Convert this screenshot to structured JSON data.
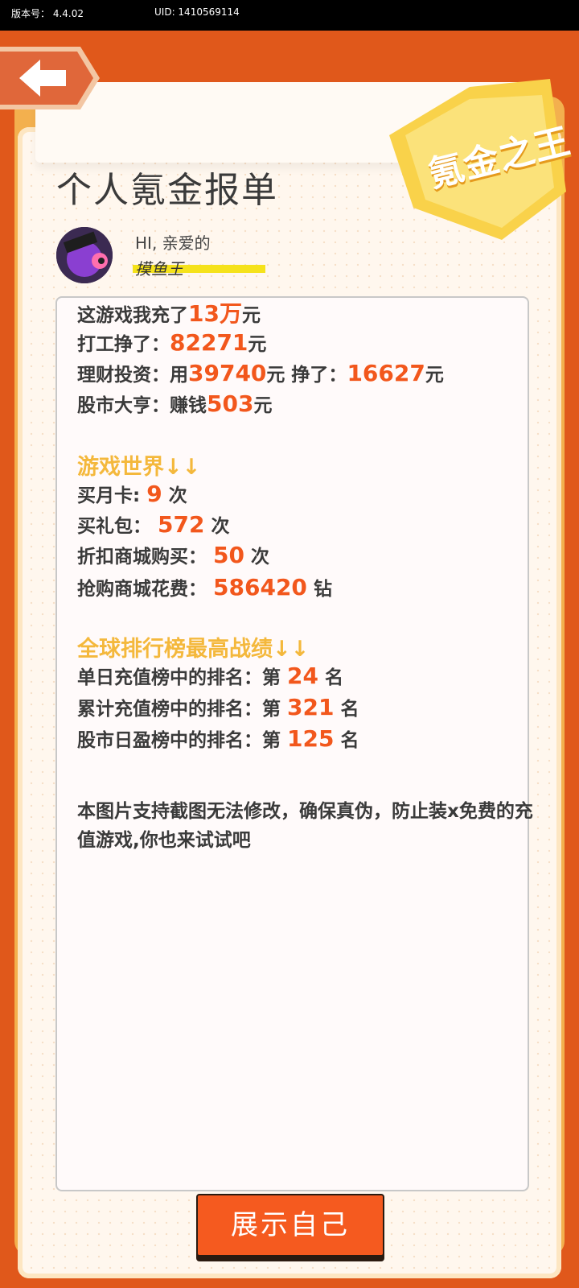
{
  "status_bar": {
    "version": "版本号： 4.4.02",
    "uid": "UID: 1410569114"
  },
  "badge": {
    "text": "氪金之王"
  },
  "title": "个人氪金报单",
  "profile": {
    "greeting": "HI, 亲爱的",
    "name": "摸鱼王"
  },
  "summary": {
    "row1": {
      "prefix": "这游戏我充了",
      "value": "13万",
      "suffix": "元"
    },
    "row2": {
      "prefix": "打工挣了：",
      "value": "82271",
      "suffix": "元"
    },
    "row3": {
      "prefix": "理财投资：用",
      "value1": "39740",
      "mid": "元 挣了：",
      "value2": "16627",
      "suffix": "元"
    },
    "row4": {
      "prefix": "股市大亨：赚钱",
      "value": "503",
      "suffix": "元"
    }
  },
  "game_world": {
    "heading": "游戏世界↓↓",
    "items": [
      {
        "label": "买月卡:",
        "value": "9",
        "unit": "次"
      },
      {
        "label": "买礼包：",
        "value": "572",
        "unit": "次"
      },
      {
        "label": "折扣商城购买：",
        "value": "50",
        "unit": "次"
      },
      {
        "label": "抢购商城花费：",
        "value": "586420",
        "unit": "钻"
      }
    ]
  },
  "ranking": {
    "heading": "全球排行榜最高战绩↓↓",
    "items": [
      {
        "label": "单日充值榜中的排名：第",
        "value": "24",
        "unit": "名"
      },
      {
        "label": "累计充值榜中的排名：第",
        "value": "321",
        "unit": "名"
      },
      {
        "label": "股市日盈榜中的排名：第",
        "value": "125",
        "unit": "名"
      }
    ]
  },
  "note": "本图片支持截图无法修改，确保真伪，防止装x免费的充值游戏,你也来试试吧",
  "show_button": "展示自己",
  "colors": {
    "accent": "#f2571c",
    "section": "#f4b83c",
    "frame": "#e0581b"
  },
  "icons": {
    "back": "back-arrow-icon",
    "avatar": "avatar-image"
  }
}
